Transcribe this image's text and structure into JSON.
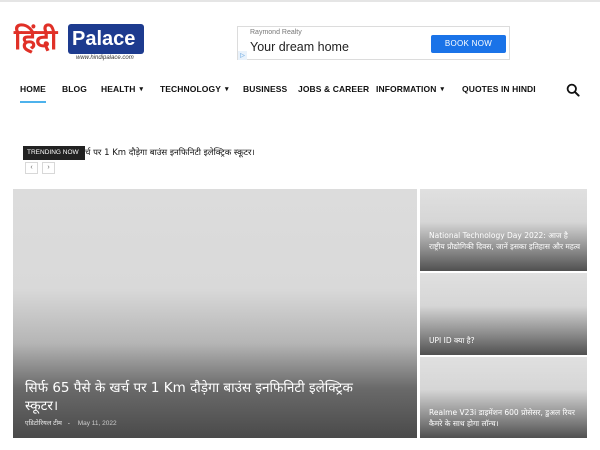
{
  "logo": {
    "hindi": "हिंदी",
    "latin": "Palace",
    "url": "www.hindipalace.com"
  },
  "ad": {
    "brand": "Raymond Realty",
    "headline": "Your dream home",
    "button": "BOOK NOW",
    "info_icon": "info-icon"
  },
  "nav": {
    "items": [
      {
        "label": "HOME",
        "active": true
      },
      {
        "label": "BLOG"
      },
      {
        "label": "HEALTH",
        "dropdown": true
      },
      {
        "label": "TECHNOLOGY",
        "dropdown": true
      },
      {
        "label": "BUSINESS"
      },
      {
        "label": "JOBS & CAREER"
      },
      {
        "label": "INFORMATION",
        "dropdown": true
      },
      {
        "label": "QUOTES IN HINDI"
      }
    ],
    "search_icon": "search-icon",
    "accent": "#4db2ec"
  },
  "trending": {
    "label": "TRENDING NOW",
    "text": "र्च पर 1 Km दौड़ेगा बाउंस इनफिनिटी इलेक्ट्रिक स्कूटर।",
    "prev": "‹",
    "next": "›"
  },
  "featured": {
    "title": "सिर्फ 65 पैसे के खर्च पर 1 Km दौड़ेगा बाउंस इनफिनिटी इलेक्ट्रिक स्कूटर।",
    "author": "एडिटोरियल टीम",
    "separator": "-",
    "date": "May 11, 2022"
  },
  "side_posts": [
    {
      "title": "National Technology Day 2022: आज है राष्ट्रीय प्रौद्योगिकी दिवस, जानें इसका इतिहास और महत्व"
    },
    {
      "title": "UPI ID क्या है?"
    },
    {
      "title": "Realme V23i डाइमेंशन 600 प्रोसेसर, डुअल रियर कैमरे के साथ होगा लॉन्च।"
    }
  ]
}
